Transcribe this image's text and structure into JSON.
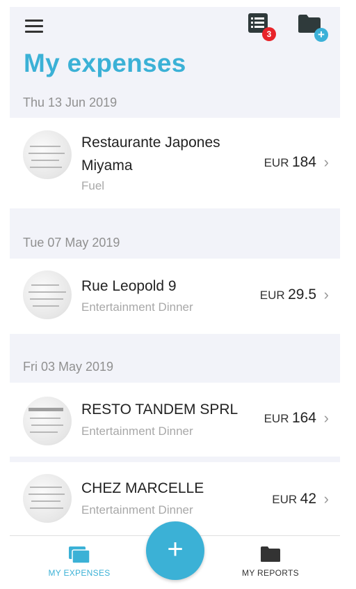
{
  "header": {
    "title": "My expenses",
    "list_badge_count": "3",
    "add_folder_symbol": "+"
  },
  "groups": [
    {
      "date": "Thu 13 Jun 2019",
      "expenses": [
        {
          "merchant": "Restaurante Japones Miyama",
          "category": "Fuel",
          "currency": "EUR",
          "amount": "184"
        }
      ]
    },
    {
      "date": "Tue 07 May 2019",
      "expenses": [
        {
          "merchant": "Rue Leopold 9",
          "category": "Entertainment Dinner",
          "currency": "EUR",
          "amount": "29.5"
        }
      ]
    },
    {
      "date": "Fri 03 May 2019",
      "expenses": [
        {
          "merchant": "RESTO TANDEM SPRL",
          "category": "Entertainment Dinner",
          "currency": "EUR",
          "amount": "164"
        },
        {
          "merchant": "CHEZ MARCELLE",
          "category": "Entertainment Dinner",
          "currency": "EUR",
          "amount": "42"
        }
      ]
    }
  ],
  "tabbar": {
    "my_expenses": "MY EXPENSES",
    "my_reports": "MY REPORTS",
    "fab_symbol": "+"
  },
  "icons": {
    "menu": "hamburger-icon",
    "list": "list-icon",
    "folder_add": "folder-add-icon",
    "expenses_tab": "stacked-cards-icon",
    "reports_tab": "folder-icon",
    "chevron": "chevron-right-icon"
  },
  "colors": {
    "accent": "#3bb1d6",
    "badge": "#e8242a",
    "background": "#f2f3f9",
    "icon_dark": "#2f3a3b"
  }
}
